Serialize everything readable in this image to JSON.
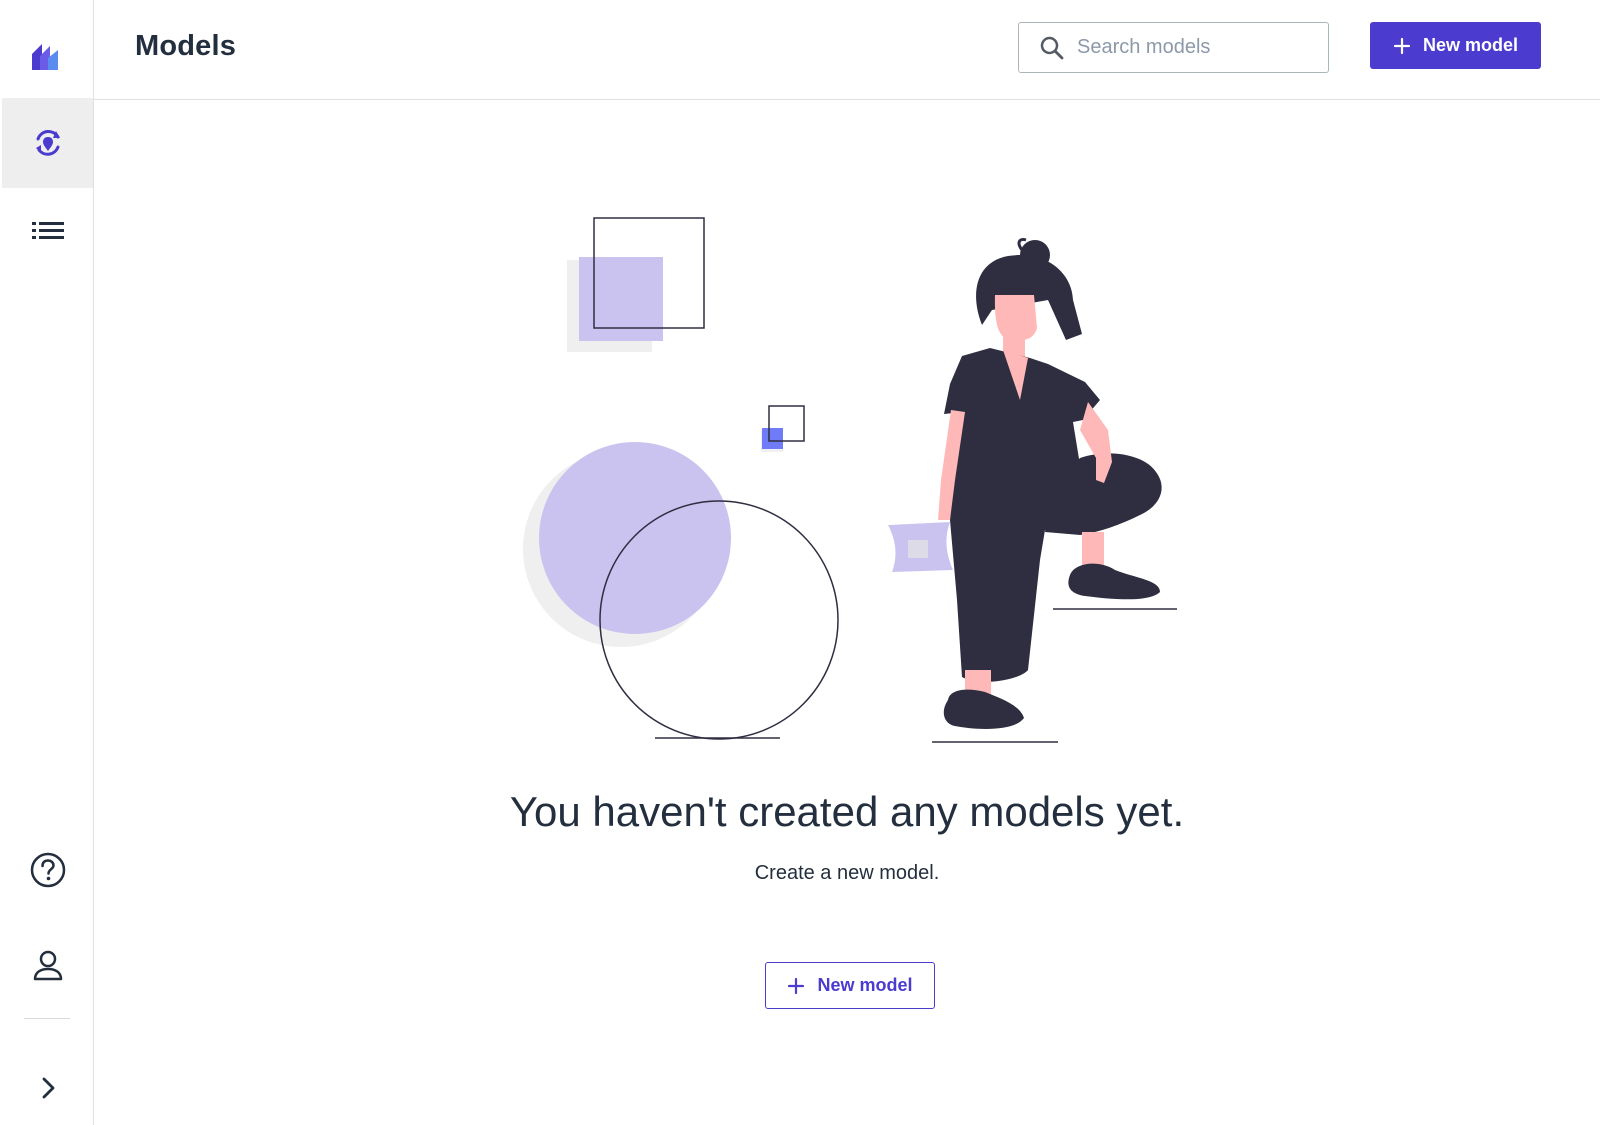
{
  "header": {
    "title": "Models",
    "search_placeholder": "Search models",
    "new_model_label": "New model"
  },
  "sidebar": {
    "items": [
      {
        "name": "logo",
        "icon": "app-logo-icon"
      },
      {
        "name": "models",
        "icon": "model-icon",
        "active": true
      },
      {
        "name": "list",
        "icon": "list-icon"
      },
      {
        "name": "help",
        "icon": "help-icon"
      },
      {
        "name": "profile",
        "icon": "user-icon"
      },
      {
        "name": "expand",
        "icon": "chevron-right-icon"
      }
    ]
  },
  "empty_state": {
    "title": "You haven't created any models yet.",
    "subtitle": "Create a new model.",
    "button_label": "New model"
  },
  "colors": {
    "accent": "#4b3bcf",
    "illustration_purple": "#cbc3ef",
    "illustration_dark": "#2f2e41",
    "skin": "#ffb8b8"
  }
}
